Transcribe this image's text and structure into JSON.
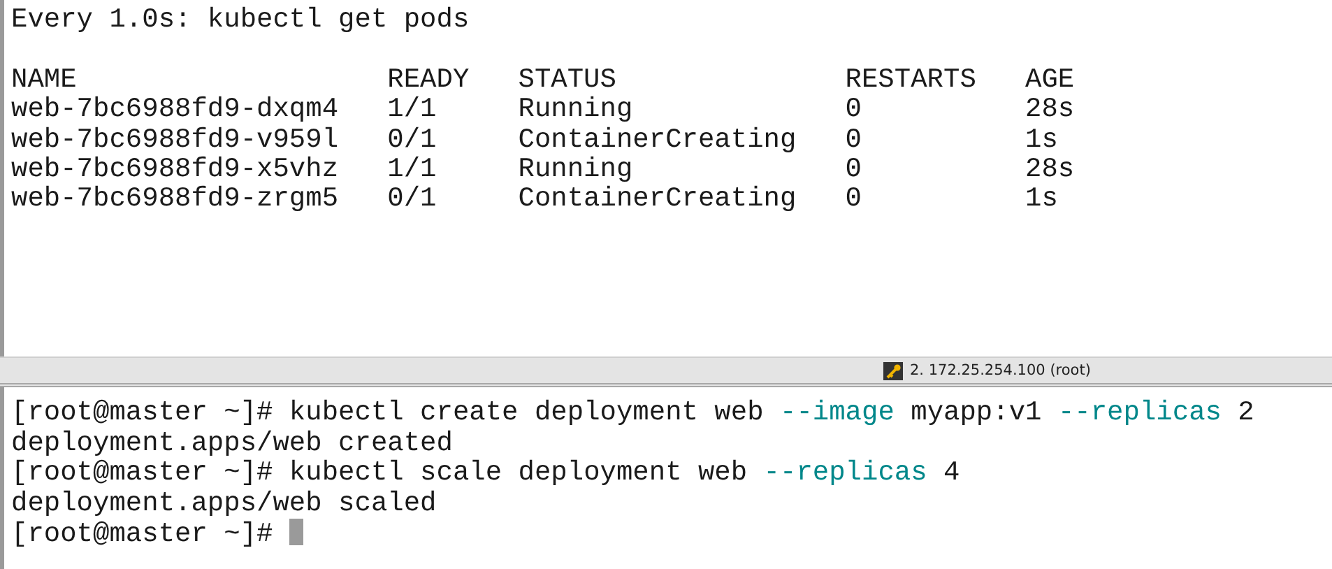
{
  "top_pane": {
    "header": "Every 1.0s: kubectl get pods",
    "table": {
      "columns": [
        "NAME",
        "READY",
        "STATUS",
        "RESTARTS",
        "AGE"
      ],
      "rows": [
        [
          "web-7bc6988fd9-dxqm4",
          "1/1",
          "Running",
          "0",
          "28s"
        ],
        [
          "web-7bc6988fd9-v959l",
          "0/1",
          "ContainerCreating",
          "0",
          "1s"
        ],
        [
          "web-7bc6988fd9-x5vhz",
          "1/1",
          "Running",
          "0",
          "28s"
        ],
        [
          "web-7bc6988fd9-zrgm5",
          "0/1",
          "ContainerCreating",
          "0",
          "1s"
        ]
      ]
    }
  },
  "status_bar": {
    "session": "2. 172.25.254.100 (root)"
  },
  "bottom_pane": {
    "lines": [
      [
        {
          "kind": "plain",
          "text": "[root@master ~]# kubectl create deployment web "
        },
        {
          "kind": "option",
          "text": "--image"
        },
        {
          "kind": "plain",
          "text": " myapp:v1 "
        },
        {
          "kind": "option",
          "text": "--replicas"
        },
        {
          "kind": "plain",
          "text": " 2"
        }
      ],
      [
        {
          "kind": "plain",
          "text": "deployment.apps/web created"
        }
      ],
      [
        {
          "kind": "plain",
          "text": "[root@master ~]# kubectl scale deployment web "
        },
        {
          "kind": "option",
          "text": "--replicas"
        },
        {
          "kind": "plain",
          "text": " 4"
        }
      ],
      [
        {
          "kind": "plain",
          "text": "deployment.apps/web scaled"
        }
      ],
      [
        {
          "kind": "plain",
          "text": "[root@master ~]# "
        }
      ]
    ],
    "cursor": true
  }
}
